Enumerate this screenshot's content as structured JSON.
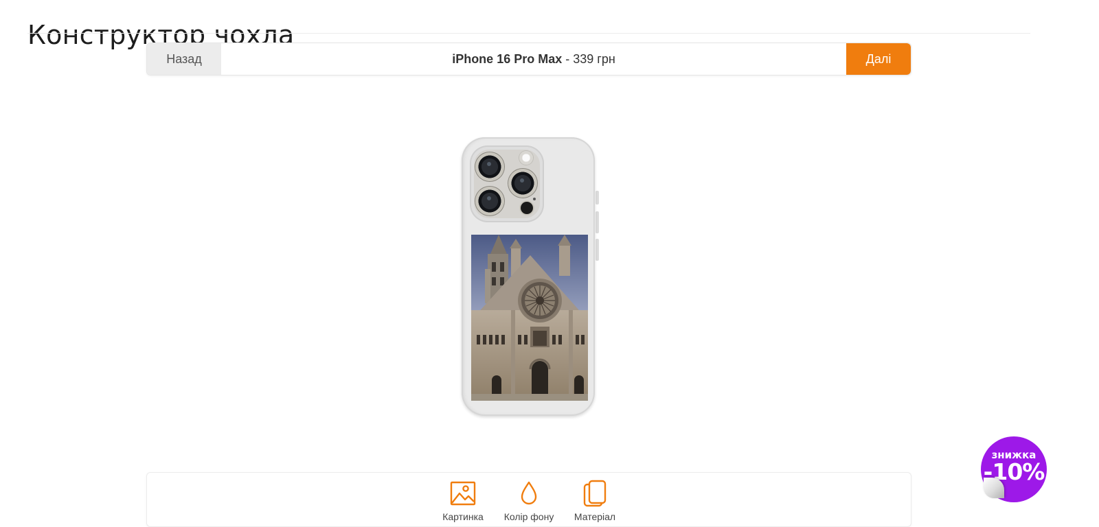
{
  "header": {
    "title": "Конструктор чохла"
  },
  "navbar": {
    "back_label": "Назад",
    "model": "iPhone 16 Pro Max",
    "separator": "-",
    "price": "339 грн",
    "next_label": "Далі"
  },
  "preview": {
    "case_color": "#e9e9e9",
    "image_subject": "cathedral facade"
  },
  "toolbar": {
    "items": [
      {
        "label": "Картинка",
        "icon": "image-icon"
      },
      {
        "label": "Колір фону",
        "icon": "drop-icon"
      },
      {
        "label": "Матеріал",
        "icon": "material-icon"
      }
    ]
  },
  "promo": {
    "top_text": "знижка",
    "main_text": "-10%",
    "color": "#9d19e8"
  },
  "colors": {
    "accent": "#f07d0e"
  }
}
